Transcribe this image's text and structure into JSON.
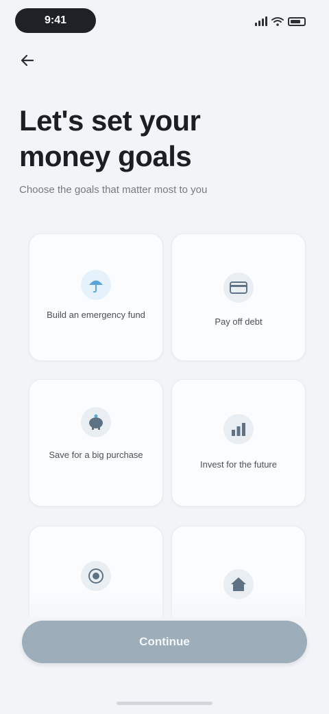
{
  "status_bar": {
    "time": "9:41",
    "icons": [
      "cellular-signal-icon",
      "wifi-icon",
      "battery-icon"
    ]
  },
  "navigation": {
    "back_icon": "arrow-left-icon",
    "back_glyph": "←"
  },
  "header": {
    "title": "Let's set your money goals",
    "subtitle": "Choose the goals that matter most to you"
  },
  "goals": [
    {
      "label": "Build an emergency fund",
      "icon": "umbrella-icon"
    },
    {
      "label": "Pay off debt",
      "icon": "credit-card-icon"
    },
    {
      "label": "Save for a big purchase",
      "icon": "piggy-bank-icon"
    },
    {
      "label": "Invest for the future",
      "icon": "chart-icon"
    },
    {
      "label": "",
      "icon": "target-icon"
    },
    {
      "label": "",
      "icon": "house-icon"
    }
  ],
  "footer": {
    "continue_label": "Continue"
  },
  "colors": {
    "background": "#f2f4f7",
    "card": "#fbfcfd",
    "button": "#9dadba",
    "icon_blue": "#5aa6d8",
    "icon_slate": "#5f7283"
  }
}
